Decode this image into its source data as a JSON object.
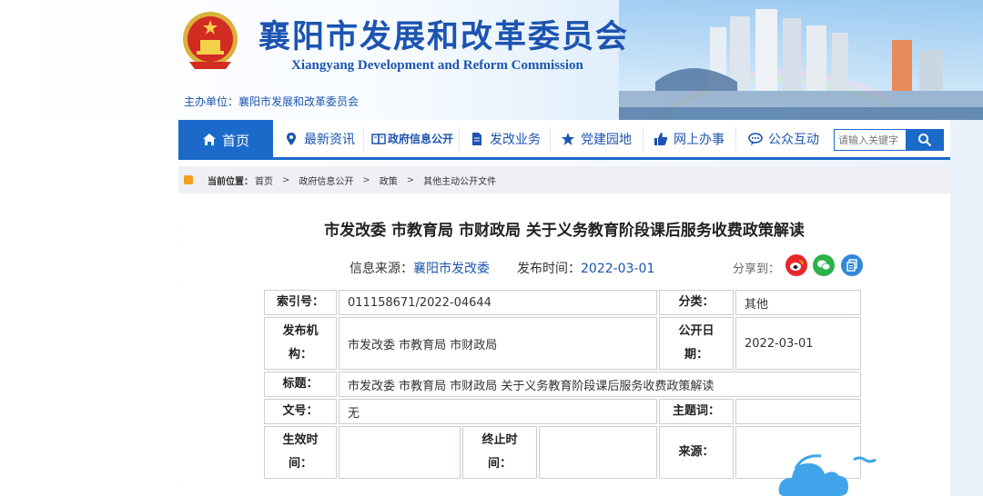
{
  "header": {
    "site_title": "襄阳市发展和改革委员会",
    "site_subtitle": "Xiangyang  Development and Reform Commission",
    "sponsor": "主办单位：襄阳市发展和改革委员会"
  },
  "nav": {
    "home": "首页",
    "items": [
      "最新资讯",
      "政府信息公开",
      "发改业务",
      "党建园地",
      "网上办事",
      "公众互动"
    ],
    "search_placeholder": "请输入关键字"
  },
  "breadcrumb": {
    "label": "当前位置：",
    "items": [
      "首页",
      "政府信息公开",
      "政策",
      "其他主动公开文件"
    ],
    "separator": ">"
  },
  "article": {
    "title": "市发改委 市教育局 市财政局 关于义务教育阶段课后服务收费政策解读",
    "source_label": "信息来源：",
    "source_value": "襄阳市发改委",
    "date_label": "发布时间：",
    "date_value": "2022-03-01",
    "share_label": "分享到："
  },
  "info": {
    "index_label": "索引号：",
    "index_value": "011158671/2022-04644",
    "category_label": "分类：",
    "category_value": "其他",
    "issuer_label_1": "发布机",
    "issuer_label_2": "构：",
    "issuer_value": "市发改委 市教育局 市财政局",
    "publish_label_1": "公开日",
    "publish_label_2": "期：",
    "publish_value": "2022-03-01",
    "title_label": "标题：",
    "title_value": "市发改委 市教育局 市财政局 关于义务教育阶段课后服务收费政策解读",
    "docno_label": "文号：",
    "docno_value": "无",
    "subject_label": "主题词：",
    "subject_value": "",
    "effective_label_1": "生效时",
    "effective_label_2": "间：",
    "effective_value": "",
    "expire_label_1": "终止时",
    "expire_label_2": "间：",
    "expire_value": "",
    "source_label": "来源：",
    "source_value": ""
  },
  "colors": {
    "brand_blue": "#1b6ac9",
    "title_blue": "#1c54b0",
    "weibo_red": "#e6282c",
    "wechat_green": "#2bb34a",
    "other_blue": "#2f88d8"
  },
  "icons": [
    "emblem-icon",
    "home-icon",
    "location-pin-icon",
    "info-public-icon",
    "document-icon",
    "star-icon",
    "thumbs-up-icon",
    "chat-icon",
    "search-icon",
    "weibo-icon",
    "wechat-icon",
    "copy-icon",
    "cloud-icon"
  ]
}
